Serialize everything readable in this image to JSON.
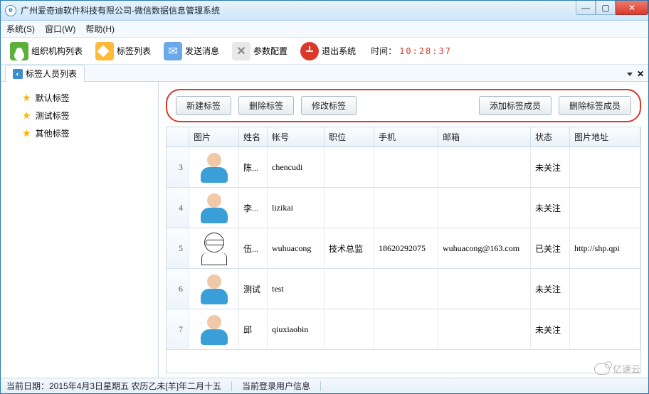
{
  "window": {
    "title": "广州爱奇迪软件科技有限公司-微信数据信息管理系统"
  },
  "menu": {
    "system": "系统(S)",
    "window": "窗口(W)",
    "help": "帮助(H)"
  },
  "toolbar": {
    "org": "组织机构列表",
    "tags": "标签列表",
    "send": "发送消息",
    "params": "参数配置",
    "exit": "退出系统",
    "time_label": "时间：",
    "time_value": "10:28:37"
  },
  "tab": {
    "label": "标签人员列表"
  },
  "sidebar": {
    "items": [
      {
        "label": "默认标签"
      },
      {
        "label": "测试标签"
      },
      {
        "label": "其他标签"
      }
    ]
  },
  "buttons": {
    "new": "新建标签",
    "delete": "删除标签",
    "edit": "修改标签",
    "addMember": "添加标签成员",
    "delMember": "删除标签成员"
  },
  "grid": {
    "headers": {
      "img": "图片",
      "name": "姓名",
      "account": "帐号",
      "position": "职位",
      "phone": "手机",
      "email": "邮箱",
      "status": "状态",
      "imgurl": "图片地址"
    },
    "rows": [
      {
        "idx": "3",
        "name": "陈...",
        "account": "chencudi",
        "position": "",
        "phone": "",
        "email": "",
        "status": "未关注",
        "imgurl": "",
        "avatar": "default"
      },
      {
        "idx": "4",
        "name": "李...",
        "account": "lizikai",
        "position": "",
        "phone": "",
        "email": "",
        "status": "未关注",
        "imgurl": "",
        "avatar": "default"
      },
      {
        "idx": "5",
        "name": "伍...",
        "account": "wuhuacong",
        "position": "技术总监",
        "phone": "18620292075",
        "email": "wuhuacong@163.com",
        "status": "已关注",
        "imgurl": "http://shp.qpi",
        "avatar": "sketch"
      },
      {
        "idx": "6",
        "name": "测试",
        "account": "test",
        "position": "",
        "phone": "",
        "email": "",
        "status": "未关注",
        "imgurl": "",
        "avatar": "default"
      },
      {
        "idx": "7",
        "name": "邱",
        "account": "qiuxiaobin",
        "position": "",
        "phone": "",
        "email": "",
        "status": "未关注",
        "imgurl": "",
        "avatar": "default"
      }
    ]
  },
  "status": {
    "date": "当前日期：2015年4月3日星期五 农历乙未[羊]年二月十五",
    "login": "当前登录用户信息"
  },
  "watermark": "亿速云"
}
